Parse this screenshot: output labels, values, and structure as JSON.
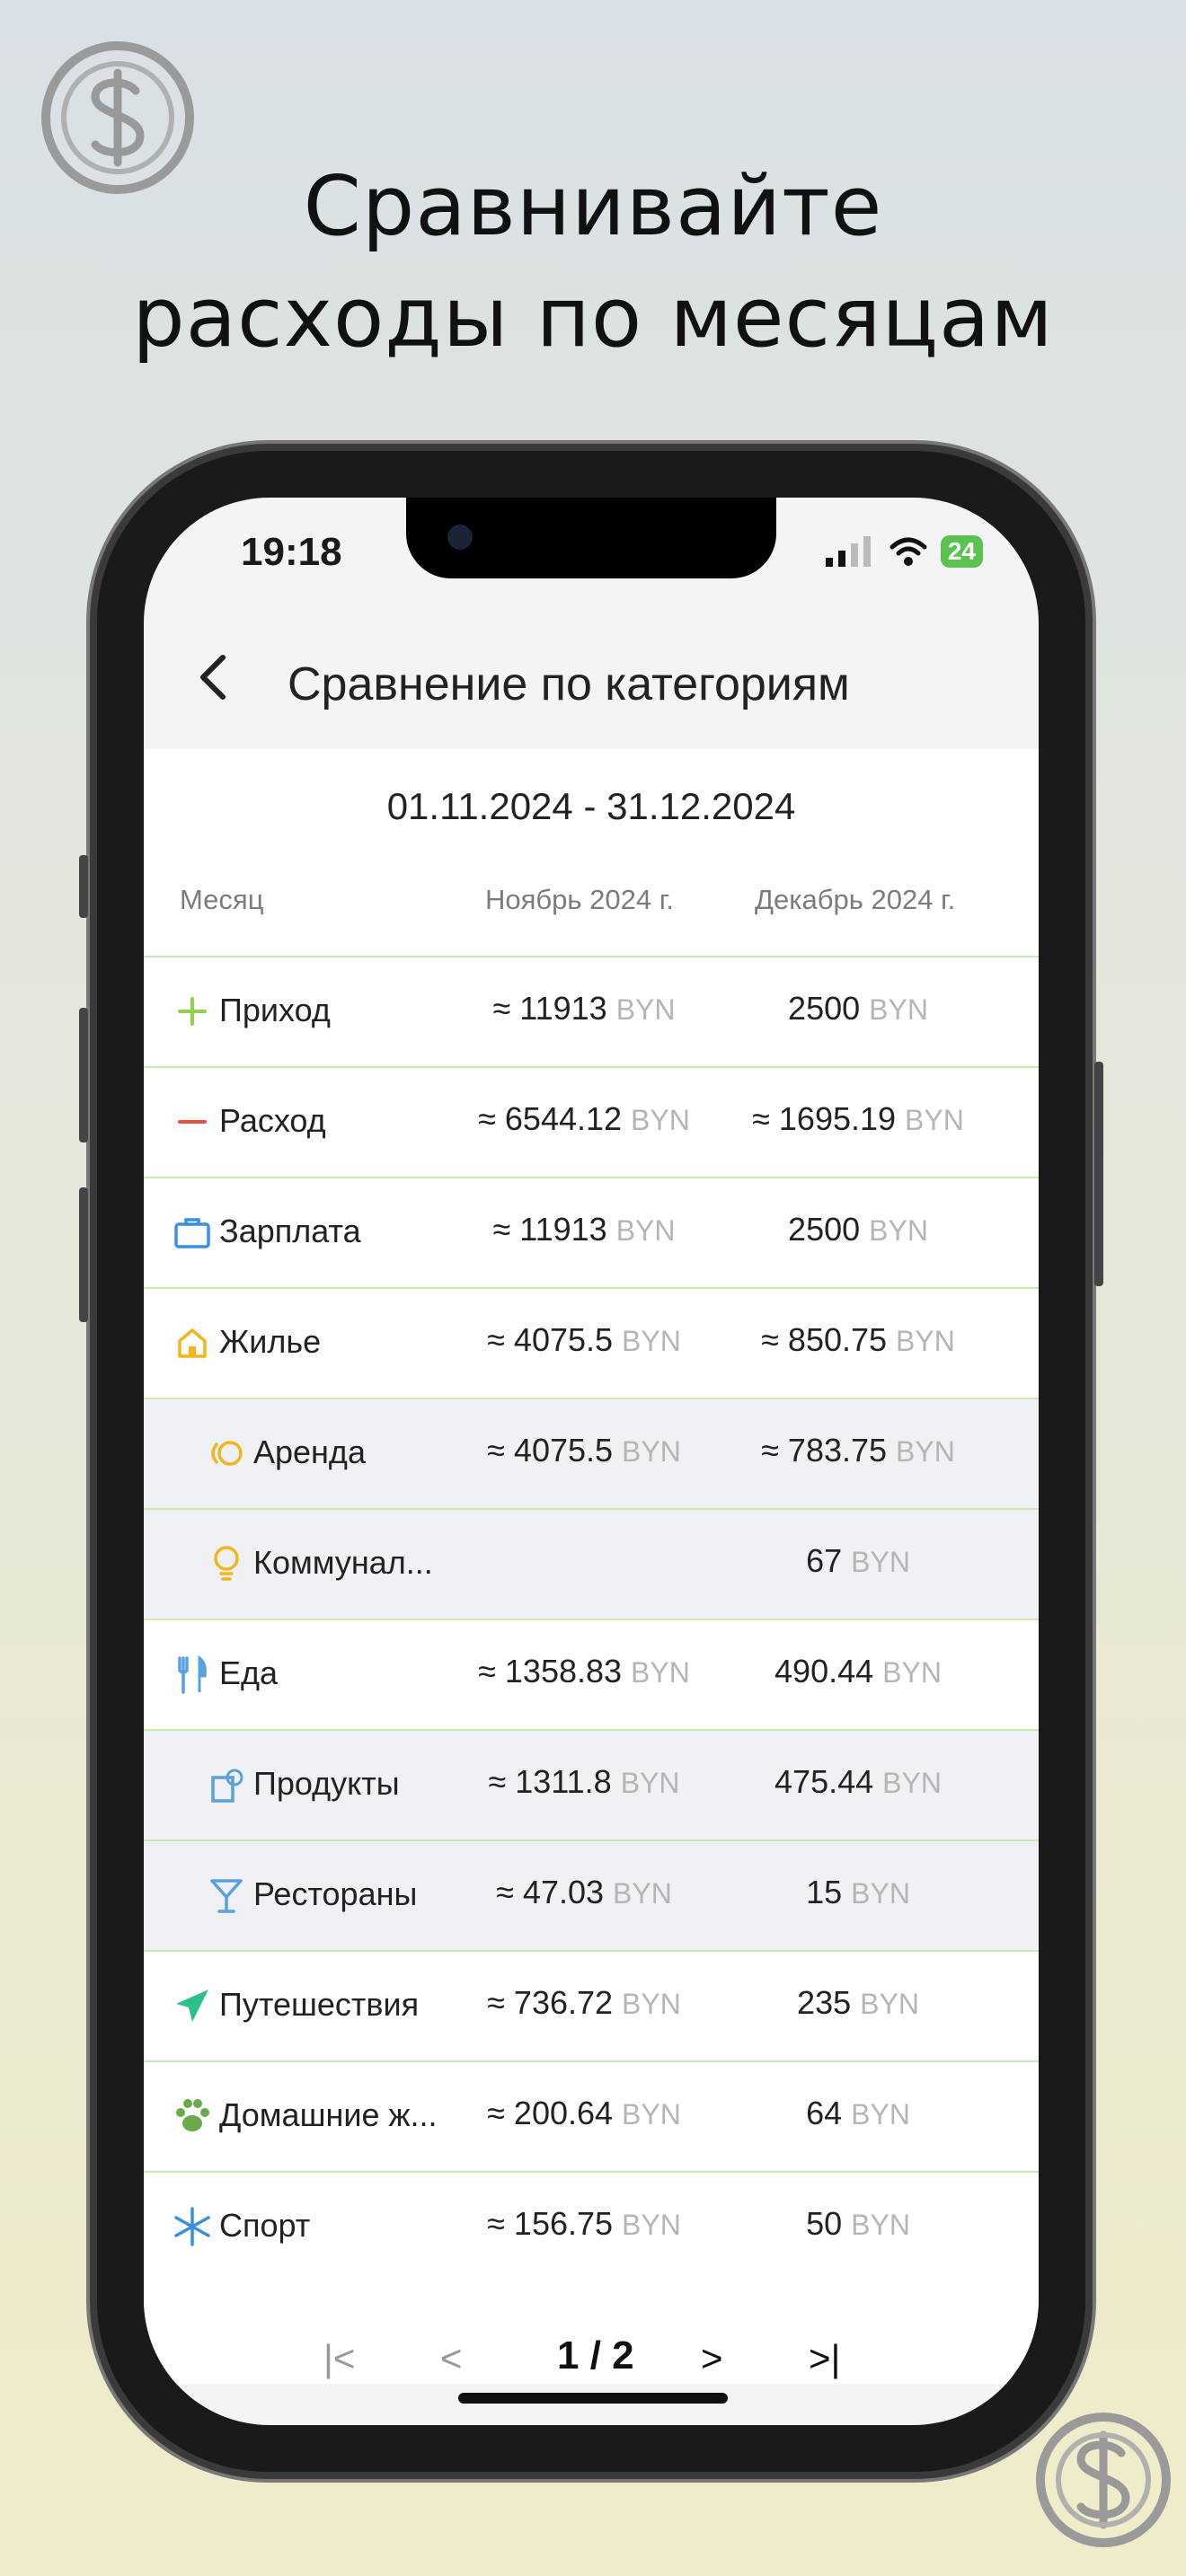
{
  "headline": {
    "line1": "Сравнивайте",
    "line2": "расходы по месяцам"
  },
  "status_bar": {
    "time": "19:18",
    "battery": "24"
  },
  "nav": {
    "title": "Сравнение по категориям"
  },
  "range": "01.11.2024 - 31.12.2024",
  "table": {
    "headers": {
      "month": "Месяц",
      "col1": "Ноябрь 2024 г.",
      "col2": "Декабрь 2024 г."
    },
    "currency": "BYN",
    "rows": [
      {
        "name": "Приход",
        "icon": "plus-icon",
        "sub": false,
        "v1": "≈ 11913",
        "v2": "2500"
      },
      {
        "name": "Расход",
        "icon": "minus-icon",
        "sub": false,
        "v1": "≈ 6544.12",
        "v2": "≈ 1695.19"
      },
      {
        "name": "Зарплата",
        "icon": "briefcase-icon",
        "sub": false,
        "v1": "≈ 11913",
        "v2": "2500"
      },
      {
        "name": "Жилье",
        "icon": "house-icon",
        "sub": false,
        "v1": "≈ 4075.5",
        "v2": "≈ 850.75"
      },
      {
        "name": "Аренда",
        "icon": "rent-icon",
        "sub": true,
        "v1": "≈ 4075.5",
        "v2": "≈ 783.75"
      },
      {
        "name": "Коммунал...",
        "icon": "lightbulb-icon",
        "sub": true,
        "v1": "",
        "v2": "67"
      },
      {
        "name": "Еда",
        "icon": "fork-knife-icon",
        "sub": false,
        "v1": "≈ 1358.83",
        "v2": "490.44"
      },
      {
        "name": "Продукты",
        "icon": "groceries-icon",
        "sub": true,
        "v1": "≈ 1311.8",
        "v2": "475.44"
      },
      {
        "name": "Рестораны",
        "icon": "cocktail-icon",
        "sub": true,
        "v1": "≈ 47.03",
        "v2": "15"
      },
      {
        "name": "Путешествия",
        "icon": "airplane-icon",
        "sub": false,
        "v1": "≈ 736.72",
        "v2": "235"
      },
      {
        "name": "Домашние ж...",
        "icon": "paw-icon",
        "sub": false,
        "v1": "≈ 200.64",
        "v2": "64"
      },
      {
        "name": "Спорт",
        "icon": "snowflake-icon",
        "sub": false,
        "v1": "≈ 156.75",
        "v2": "50"
      }
    ]
  },
  "pager": {
    "page": "1 / 2"
  },
  "colors": {
    "accent_green": "#59c34d",
    "row_divider": "#c8ecb0",
    "sub_row_bg": "#eff1f4"
  }
}
